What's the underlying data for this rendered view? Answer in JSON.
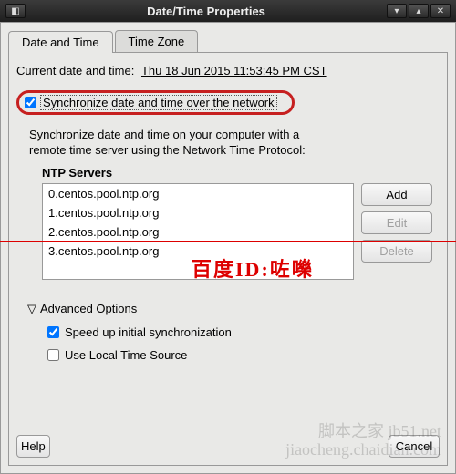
{
  "window": {
    "title": "Date/Time Properties"
  },
  "tabs": {
    "date_time": "Date and Time",
    "time_zone": "Time Zone"
  },
  "panel": {
    "current_label": "Current date and time:",
    "current_value": "Thu 18 Jun 2015 11:53:45 PM CST",
    "sync_label": "Synchronize date and time over the network",
    "desc_line1": "Synchronize date and time on your computer with a",
    "desc_line2": "remote time server using the Network Time Protocol:"
  },
  "ntp": {
    "header": "NTP Servers",
    "servers": [
      "0.centos.pool.ntp.org",
      "1.centos.pool.ntp.org",
      "2.centos.pool.ntp.org",
      "3.centos.pool.ntp.org"
    ],
    "buttons": {
      "add": "Add",
      "edit": "Edit",
      "delete": "Delete"
    }
  },
  "advanced": {
    "header": "Advanced Options",
    "speed_up": "Speed up initial synchronization",
    "local_time": "Use Local Time Source",
    "speed_up_checked": true,
    "local_time_checked": false
  },
  "footer": {
    "help": "Help",
    "cancel": "Cancel"
  },
  "overlay": {
    "baidu_id": "百度ID:咗嚛",
    "site1": "脚本之家 jb51.net",
    "site2": "jiaocheng.chaidian.com"
  }
}
